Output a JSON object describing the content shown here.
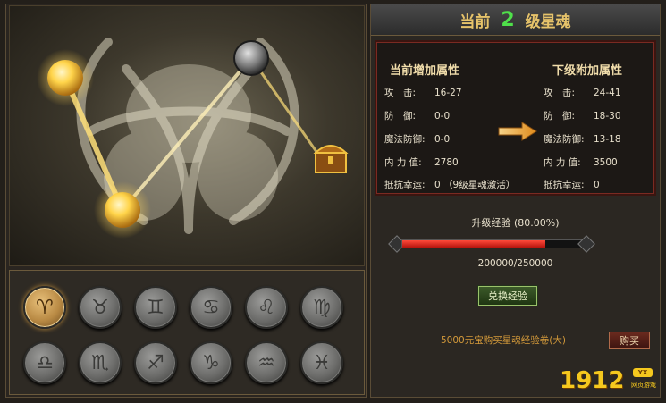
{
  "header": {
    "prefix": "当前",
    "level": "2",
    "suffix": "级星魂"
  },
  "current": {
    "title": "当前增加属性",
    "rows": [
      {
        "label": "攻　击:",
        "value": "16-27"
      },
      {
        "label": "防　御:",
        "value": "0-0"
      },
      {
        "label": "魔法防御:",
        "value": "0-0"
      },
      {
        "label": "内 力 值:",
        "value": "2780"
      },
      {
        "label": "抵抗幸运:",
        "value": "0 （9级星魂激活）"
      }
    ]
  },
  "next": {
    "title": "下级附加属性",
    "rows": [
      {
        "label": "攻　击:",
        "value": "24-41"
      },
      {
        "label": "防　御:",
        "value": "18-30"
      },
      {
        "label": "魔法防御:",
        "value": "13-18"
      },
      {
        "label": "内 力 值:",
        "value": "3500"
      },
      {
        "label": "抵抗幸运:",
        "value": "0"
      }
    ]
  },
  "exp": {
    "label": "升级经验 (80.00%)",
    "progress": 0.8,
    "text": "200000/250000"
  },
  "exchange_button": "兑换经验",
  "buy": {
    "text": "5000元宝购买星魂经验卷(大)",
    "button": "购买"
  },
  "zodiac_icons": [
    "aries-icon",
    "taurus-icon",
    "gemini-icon",
    "cancer-icon",
    "leo-icon",
    "virgo-icon",
    "libra-icon",
    "scorpio-icon",
    "sagittarius-icon",
    "capricorn-icon",
    "aquarius-icon",
    "pisces-icon"
  ],
  "zodiac_glyphs": [
    "♈",
    "♉",
    "♊",
    "♋",
    "♌",
    "♍",
    "♎",
    "♏",
    "♐",
    "♑",
    "♒",
    "♓"
  ],
  "watermark": {
    "number": "1912",
    "badge": "YX",
    "caption": "网页游戏"
  },
  "colors": {
    "accent_gold": "#e6c36a",
    "level_green": "#4fe04a",
    "bar_red": "#d42418"
  }
}
